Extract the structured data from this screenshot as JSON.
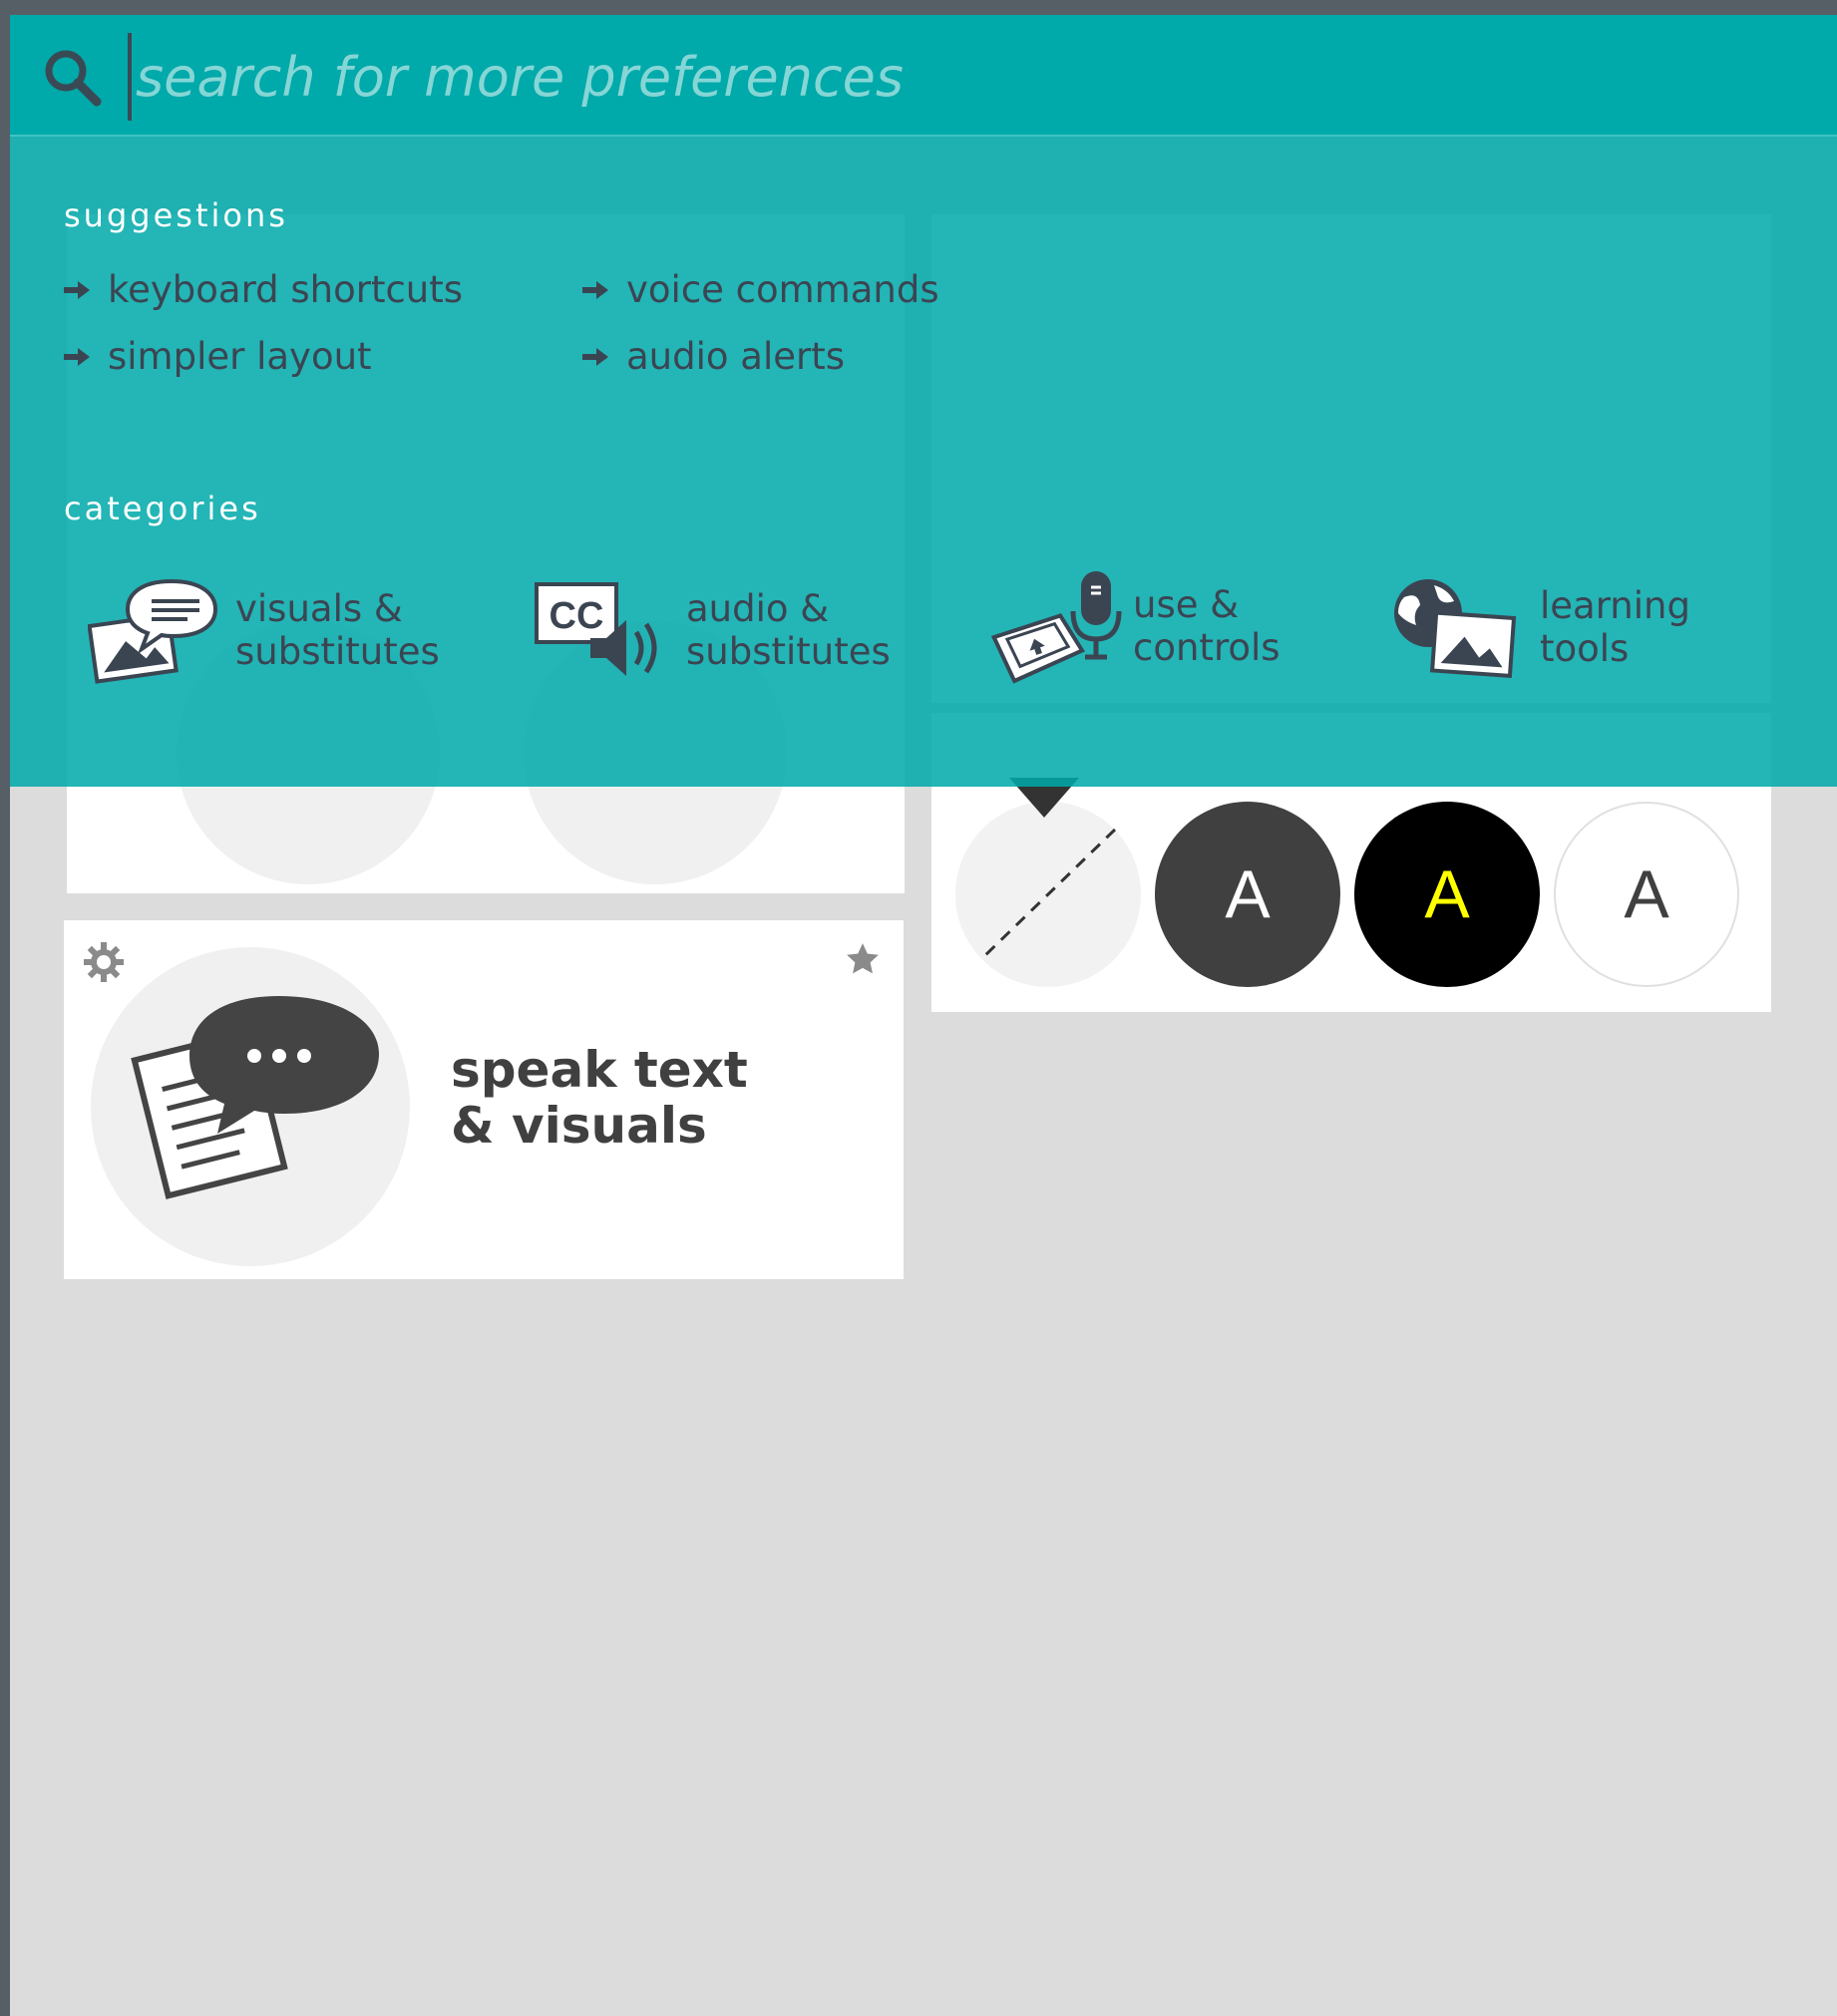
{
  "search": {
    "placeholder": "search for more preferences",
    "value": ""
  },
  "suggestions": {
    "title": "suggestions",
    "items": [
      "keyboard shortcuts",
      "voice commands",
      "simpler layout",
      "audio alerts"
    ]
  },
  "categories": {
    "title": "categories",
    "items": [
      {
        "label": "visuals &\nsubstitutes",
        "icon": "visuals-substitutes-icon"
      },
      {
        "label": "audio &\nsubstitutes",
        "icon": "cc-audio-icon"
      },
      {
        "label": "use &\ncontrols",
        "icon": "keyboard-mic-icon"
      },
      {
        "label": "learning\ntools",
        "icon": "globe-picture-icon"
      }
    ]
  },
  "cards": {
    "speak_text": {
      "title": "speak text\n& visuals"
    },
    "contrast": {
      "swatches": [
        {
          "letter": "",
          "bg": "#f2f2f2",
          "fg": "#333333",
          "state": "off"
        },
        {
          "letter": "A",
          "bg": "#404040",
          "fg": "#ffffff"
        },
        {
          "letter": "A",
          "bg": "#000000",
          "fg": "#ffff00"
        },
        {
          "letter": "A",
          "bg": "#ffffff",
          "fg": "#404040"
        }
      ]
    }
  },
  "colors": {
    "panel": "#00a9aa",
    "text_dark": "#3b4552",
    "background": "#dcdcdc"
  }
}
